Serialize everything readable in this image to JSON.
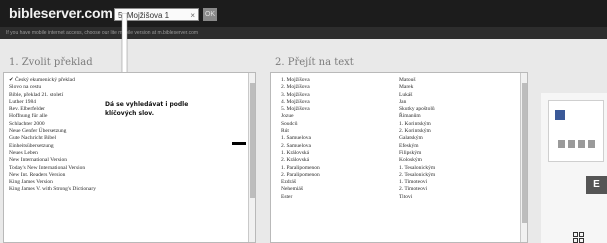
{
  "header": {
    "logo": "bibleserver.com",
    "search_value": "5. Mojžišova 1",
    "search_clear": "×",
    "ok_label": "OK"
  },
  "notice": "If you have mobile internet access, choose our lite mobile version at m.bibleserver.com",
  "tooltip": "Dá se vyhledávat i podle klíčových slov.",
  "translation": {
    "heading": "1. Zvolit překlad",
    "items": [
      "✔ Český ekumenický překlad",
      "Slovo na cestu",
      "Bible, překlad 21. století",
      "Luther 1984",
      "Rev. Elberfelder",
      "Hoffnung für alle",
      "Schlachter 2000",
      "Neue Genfer Übersetzung",
      "Gute Nachricht Bibel",
      "Einheitsübersetzung",
      "Neues Leben",
      "New International Version",
      "Today's New International Version",
      "New Int. Readers Version",
      "King James Version",
      "King James V. with Strong's Dictionary"
    ]
  },
  "text": {
    "heading": "2. Přejít na text",
    "col1": [
      "1. Mojžíšova",
      "2. Mojžíšova",
      "3. Mojžíšova",
      "4. Mojžíšova",
      "5. Mojžíšova",
      "Jozue",
      "Soudců",
      "Rút",
      "1. Samuelova",
      "2. Samuelova",
      "1. Královská",
      "2. Královská",
      "1. Paralipomenon",
      "2. Paralipomenon",
      "Ezdráš",
      "Nehemiáš",
      "Ester"
    ],
    "col2": [
      "Matouš",
      "Marek",
      "Lukáš",
      "Jan",
      "Skutky apoštolů",
      "Římanům",
      "1. Korintským",
      "2. Korintským",
      "Galatským",
      "Efeským",
      "Filipským",
      "Koloským",
      "1. Tesalonickým",
      "2. Tesalonickým",
      "1. Timoteovi",
      "2. Timoteovi",
      "Titovi"
    ]
  },
  "colors": {
    "topbar": "#1c1c1c",
    "accent": "#3b5998"
  }
}
